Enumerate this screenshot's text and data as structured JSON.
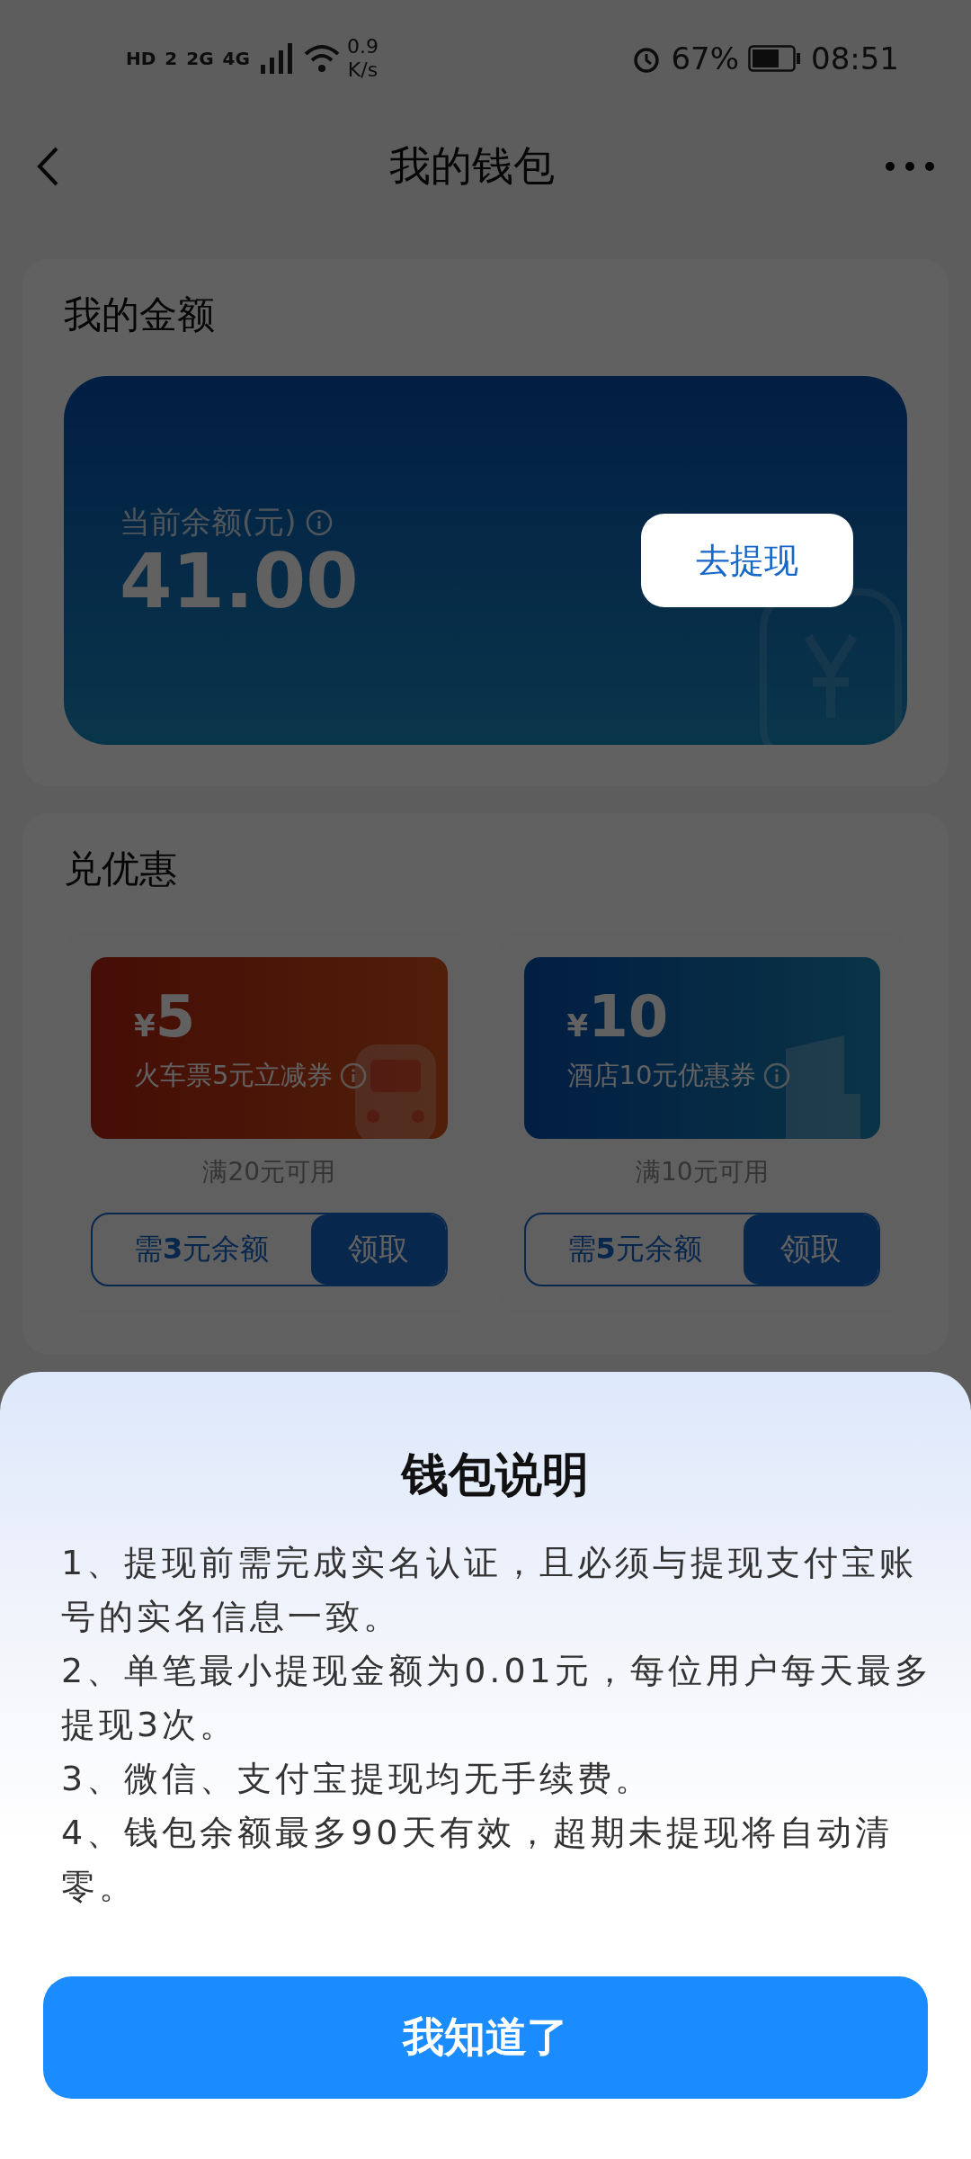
{
  "status_bar": {
    "indicators": [
      "HD",
      "2",
      "2G",
      "4G"
    ],
    "network_speed": "0.9",
    "network_speed_unit": "K/s",
    "battery": "67%",
    "time": "08:51"
  },
  "nav": {
    "title": "我的钱包"
  },
  "balance_section": {
    "title": "我的金额",
    "label": "当前余额(元)",
    "amount": "41.00",
    "withdraw_button": "去提现"
  },
  "coupon_section": {
    "title": "兑优惠",
    "coupons": [
      {
        "kind": "train",
        "currency": "¥",
        "amount": "5",
        "name": "火车票5元立减券",
        "condition": "满20元可用",
        "requirement": "需**3**元余额",
        "claim_button": "领取"
      },
      {
        "kind": "hotel",
        "currency": "¥",
        "amount": "10",
        "name": "酒店10元优惠券",
        "condition": "满10元可用",
        "requirement": "需**5**元余额",
        "claim_button": "领取"
      }
    ]
  },
  "sheet": {
    "title": "钱包说明",
    "items": [
      "1、提现前需完成实名认证，且必须与提现支付宝账号的实名信息一致。",
      "2、单笔最小提现金额为0.01元，每位用户每天最多提现3次。",
      "3、微信、支付宝提现均无手续费。",
      "4、钱包余额最多90天有效，超期未提现将自动清零。"
    ],
    "confirm_button": "我知道了"
  }
}
